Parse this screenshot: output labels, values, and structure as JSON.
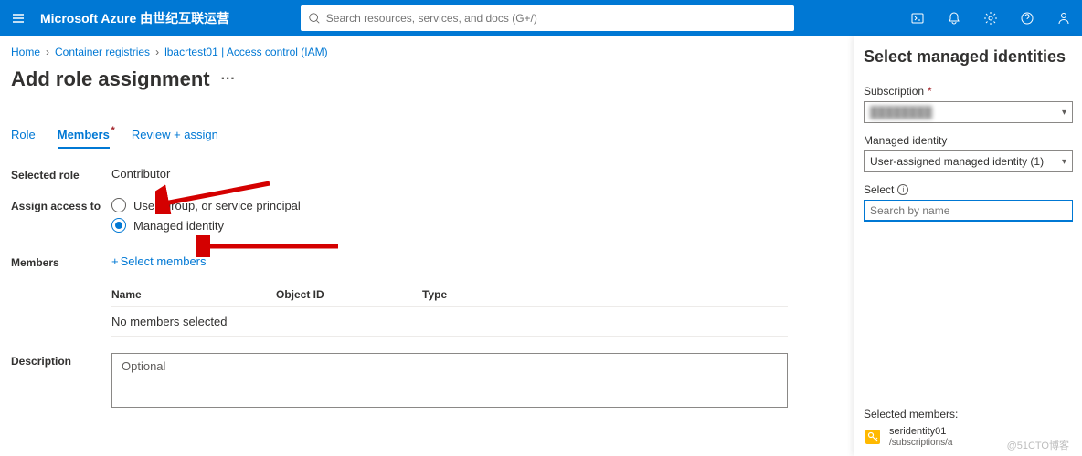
{
  "topbar": {
    "brand": "Microsoft Azure 由世纪互联运营",
    "search_placeholder": "Search resources, services, and docs (G+/)"
  },
  "breadcrumb": {
    "items": [
      "Home",
      "Container registries",
      "lbacrtest01 | Access control (IAM)"
    ]
  },
  "page": {
    "title": "Add role assignment"
  },
  "tabs": {
    "role": "Role",
    "members": "Members",
    "review": "Review + assign"
  },
  "form": {
    "selected_role_label": "Selected role",
    "selected_role_value": "Contributor",
    "assign_label": "Assign access to",
    "opt1": "User, group, or service principal",
    "opt2": "Managed identity",
    "members_label": "Members",
    "select_members": "Select members",
    "th_name": "Name",
    "th_obj": "Object ID",
    "th_type": "Type",
    "empty": "No members selected",
    "desc_label": "Description",
    "desc_placeholder": "Optional"
  },
  "panel": {
    "title": "Select managed identities",
    "subscription_label": "Subscription",
    "subscription_value": "████████",
    "managed_label": "Managed identity",
    "managed_value": "User-assigned managed identity (1)",
    "select_label": "Select",
    "search_placeholder": "Search by name",
    "selected_label": "Selected members:",
    "member_name": "seridentity01",
    "member_sub": "/subscriptions/a"
  },
  "watermark": "@51CTO博客"
}
